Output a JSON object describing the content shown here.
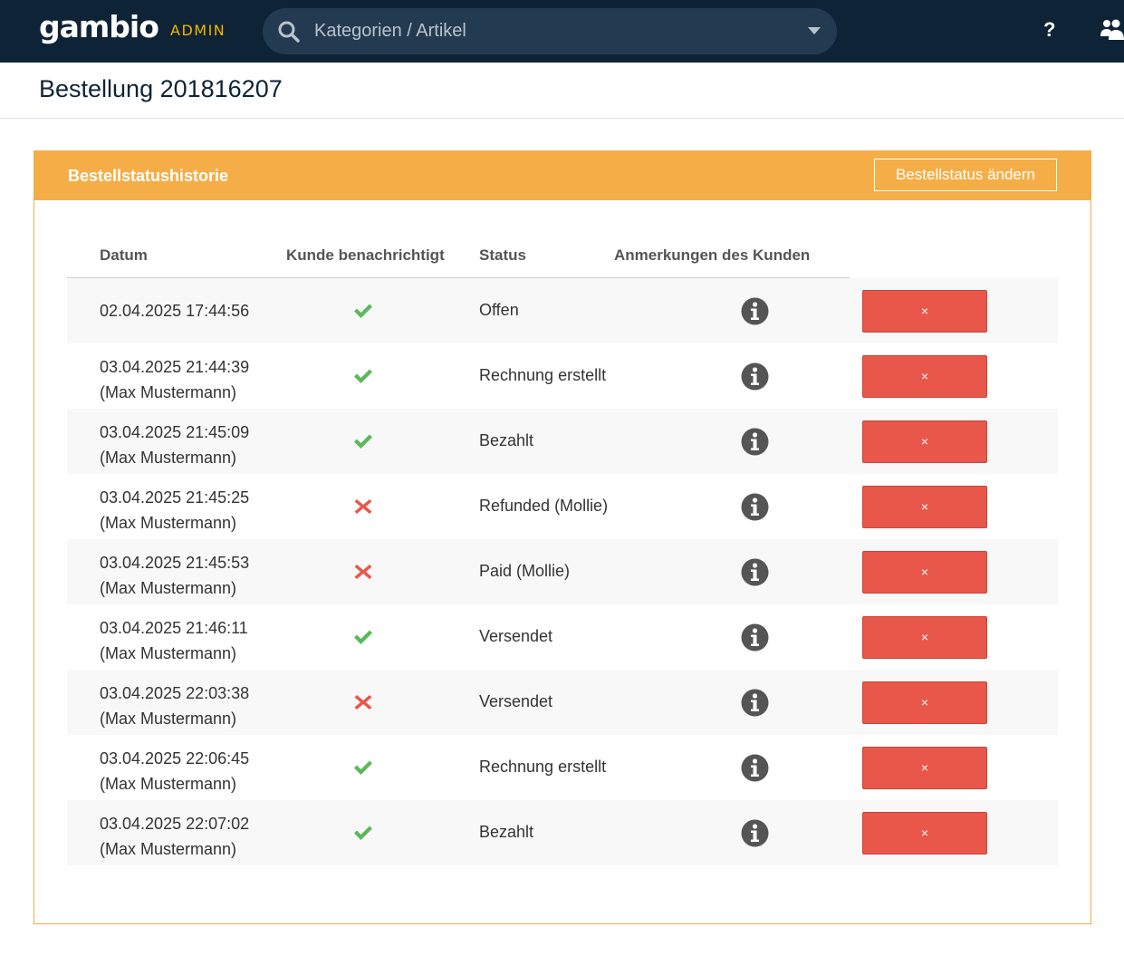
{
  "topbar": {
    "logo": "gambio",
    "admin_label": "ADMIN",
    "search_placeholder": "Kategorien / Artikel",
    "help_label": "?"
  },
  "page": {
    "title": "Bestellung 201816207"
  },
  "panel": {
    "title": "Bestellstatushistorie",
    "change_status_label": "Bestellstatus ändern",
    "columns": [
      "Datum",
      "Kunde benachrichtigt",
      "Status",
      "Anmerkungen des Kunden"
    ],
    "delete_label": "×",
    "rows": [
      {
        "date": "02.04.2025 17:44:56",
        "user": "",
        "notified": true,
        "status": "Offen"
      },
      {
        "date": "03.04.2025 21:44:39",
        "user": "(Max Mustermann)",
        "notified": true,
        "status": "Rechnung erstellt"
      },
      {
        "date": "03.04.2025 21:45:09",
        "user": "(Max Mustermann)",
        "notified": true,
        "status": "Bezahlt"
      },
      {
        "date": "03.04.2025 21:45:25",
        "user": "(Max Mustermann)",
        "notified": false,
        "status": "Refunded (Mollie)"
      },
      {
        "date": "03.04.2025 21:45:53",
        "user": "(Max Mustermann)",
        "notified": false,
        "status": "Paid (Mollie)"
      },
      {
        "date": "03.04.2025 21:46:11",
        "user": "(Max Mustermann)",
        "notified": true,
        "status": "Versendet"
      },
      {
        "date": "03.04.2025 22:03:38",
        "user": "(Max Mustermann)",
        "notified": false,
        "status": "Versendet"
      },
      {
        "date": "03.04.2025 22:06:45",
        "user": "(Max Mustermann)",
        "notified": true,
        "status": "Rechnung erstellt"
      },
      {
        "date": "03.04.2025 22:07:02",
        "user": "(Max Mustermann)",
        "notified": true,
        "status": "Bezahlt"
      }
    ]
  },
  "colors": {
    "topbar_bg": "#0f2336",
    "accent": "#f5ae47",
    "admin_label": "#f5b300",
    "check_green": "#5cb85c",
    "cross_red": "#e8574a",
    "delete_button": "#e8574a"
  },
  "icons": {
    "search": "search-icon",
    "caret": "chevron-down-icon",
    "users": "users-icon",
    "notified_yes": "check-icon",
    "notified_no": "cross-icon",
    "comment": "info-icon"
  }
}
